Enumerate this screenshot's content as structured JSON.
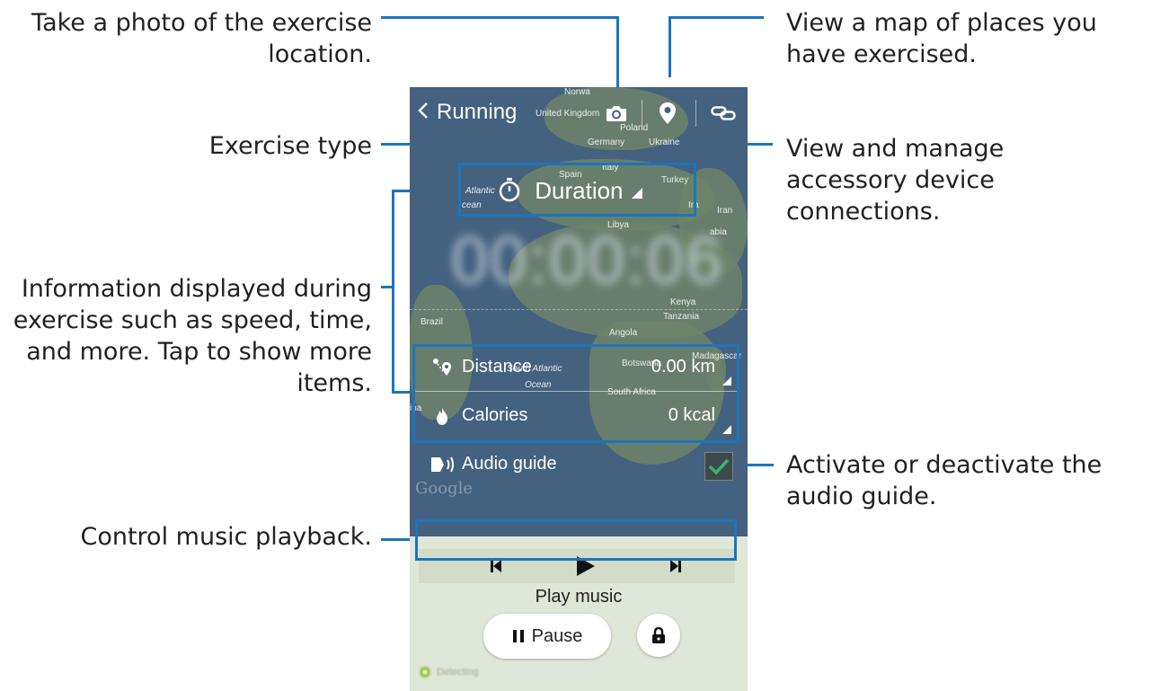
{
  "annotations": {
    "photo": "Take a photo of the exercise location.",
    "map": "View a map of places you have exercised.",
    "exercise_type": "Exercise type",
    "accessory": "View and manage accessory device connections.",
    "info": "Information displayed during exercise such as speed, time, and more. Tap to show more items.",
    "audio": "Activate or deactivate the audio guide.",
    "music": "Control music playback."
  },
  "app": {
    "title": "Running",
    "icons": [
      "back-icon",
      "camera-icon",
      "map-pin-icon",
      "link-icon"
    ]
  },
  "map_labels": {
    "norway": "Norwa",
    "uk": "United Kingdom",
    "poland": "Poland",
    "germany": "Germany",
    "ukraine": "Ukraine",
    "spain": "Spain",
    "italy": "Italy",
    "turkey": "Turkey",
    "atlantic": "Atlantic",
    "ocean": "cean",
    "iraq": "Ira",
    "iran": "Iran",
    "libya": "Libya",
    "arabia": "abia",
    "kenya": "Kenya",
    "tanzania": "Tanzania",
    "brazil": "Brazil",
    "angola": "Angola",
    "madagascar": "Madagascar",
    "botswana": "Botswana",
    "south_atlantic": "South Atlantic",
    "ocean2": "Ocean",
    "south_africa": "South Africa",
    "na": "ina"
  },
  "duration": {
    "label": "Duration",
    "value": "00:00:06"
  },
  "stats": [
    {
      "label": "Distance",
      "value": "0.00 km",
      "icon": "route-icon"
    },
    {
      "label": "Calories",
      "value": "0 kcal",
      "icon": "flame-icon"
    }
  ],
  "audio_guide": {
    "label": "Audio guide",
    "checked": true
  },
  "google_logo": "Google",
  "music": {
    "play_music": "Play music",
    "pause_label": "Pause"
  },
  "status": {
    "detecting": "Detecting"
  },
  "colors": {
    "accent": "#1b75bc",
    "check": "#3cb371",
    "map": "#44617f",
    "bottom_panel": "#dfe7d8"
  }
}
